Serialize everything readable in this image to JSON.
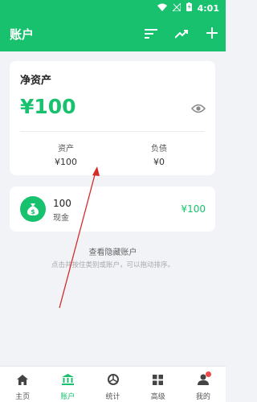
{
  "status_bar": {
    "time": "4:01"
  },
  "app_bar": {
    "title": "账户"
  },
  "net_worth": {
    "label": "净资产",
    "amount": "¥100",
    "assets_label": "资产",
    "assets_value": "¥100",
    "liabilities_label": "负债",
    "liabilities_value": "¥0"
  },
  "cash_account": {
    "name": "100",
    "type": "现金",
    "amount": "¥100"
  },
  "view_hidden": "查看隐藏账户",
  "hint": "点击并按住类别或账户，可以拖动排序。",
  "tabs": [
    {
      "label": "主页"
    },
    {
      "label": "账户"
    },
    {
      "label": "统计"
    },
    {
      "label": "高级"
    },
    {
      "label": "我的"
    }
  ],
  "colors": {
    "accent": "#18c16d",
    "badge": "#f04848",
    "annotation_arrow": "#d62b2b"
  }
}
